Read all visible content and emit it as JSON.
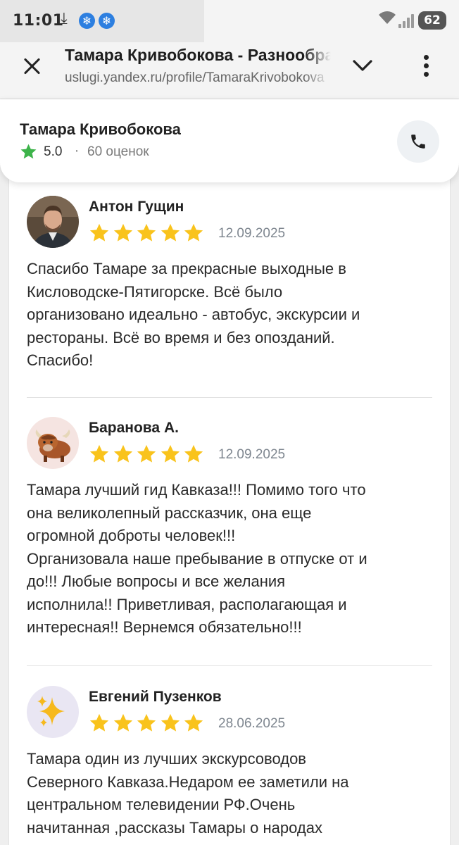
{
  "status_bar": {
    "time": "11:01",
    "battery": "62"
  },
  "browser": {
    "title": "Тамара Кривобокова - Разнообразные",
    "url": "uslugi.yandex.ru/profile/TamaraKrivobokova"
  },
  "profile": {
    "name": "Тамара Кривобокова",
    "rating": "5.0",
    "separator": "·",
    "ratings_count": "60 оценок",
    "star_color": "#3db34a"
  },
  "reviews": [
    {
      "author": "Антон Гущин",
      "stars": 5,
      "date": "12.09.2025",
      "text": "Спасибо Тамаре за прекрасные выходные в\nКисловодске-Пятигорске. Всё было\nорганизовано идеально - автобус, экскурсии и\nрестораны. Всё во время и без опозданий.\nСпасибо!",
      "avatar": "person-photo"
    },
    {
      "author": "Баранова А.",
      "stars": 5,
      "date": "12.09.2025",
      "text": "Тамара лучший гид Кавказа!!! Помимо того что\nона великолепный рассказчик, она еще\nогромной доброты человек!!!\nОрганизовала наше пребывание в отпуске от и\nдо!!! Любые вопросы и все желания\nисполнила!! Приветливая, располагающая и\nинтересная!! Вернемся обязательно!!!",
      "avatar": "yak-icon"
    },
    {
      "author": "Евгений Пузенков",
      "stars": 5,
      "date": "28.06.2025",
      "text": "Тамара один из лучших экскурсоводов\nСеверного Кавказа.Недаром ее заметили на\nцентральном телевидении РФ.Очень\nначитанная ,рассказы Тамары о народах",
      "avatar": "sparkles-icon"
    }
  ],
  "colors": {
    "review_star": "#f9c31c",
    "rating_star": "#3db34a",
    "snowflake_badge": "#2d7fe0"
  }
}
